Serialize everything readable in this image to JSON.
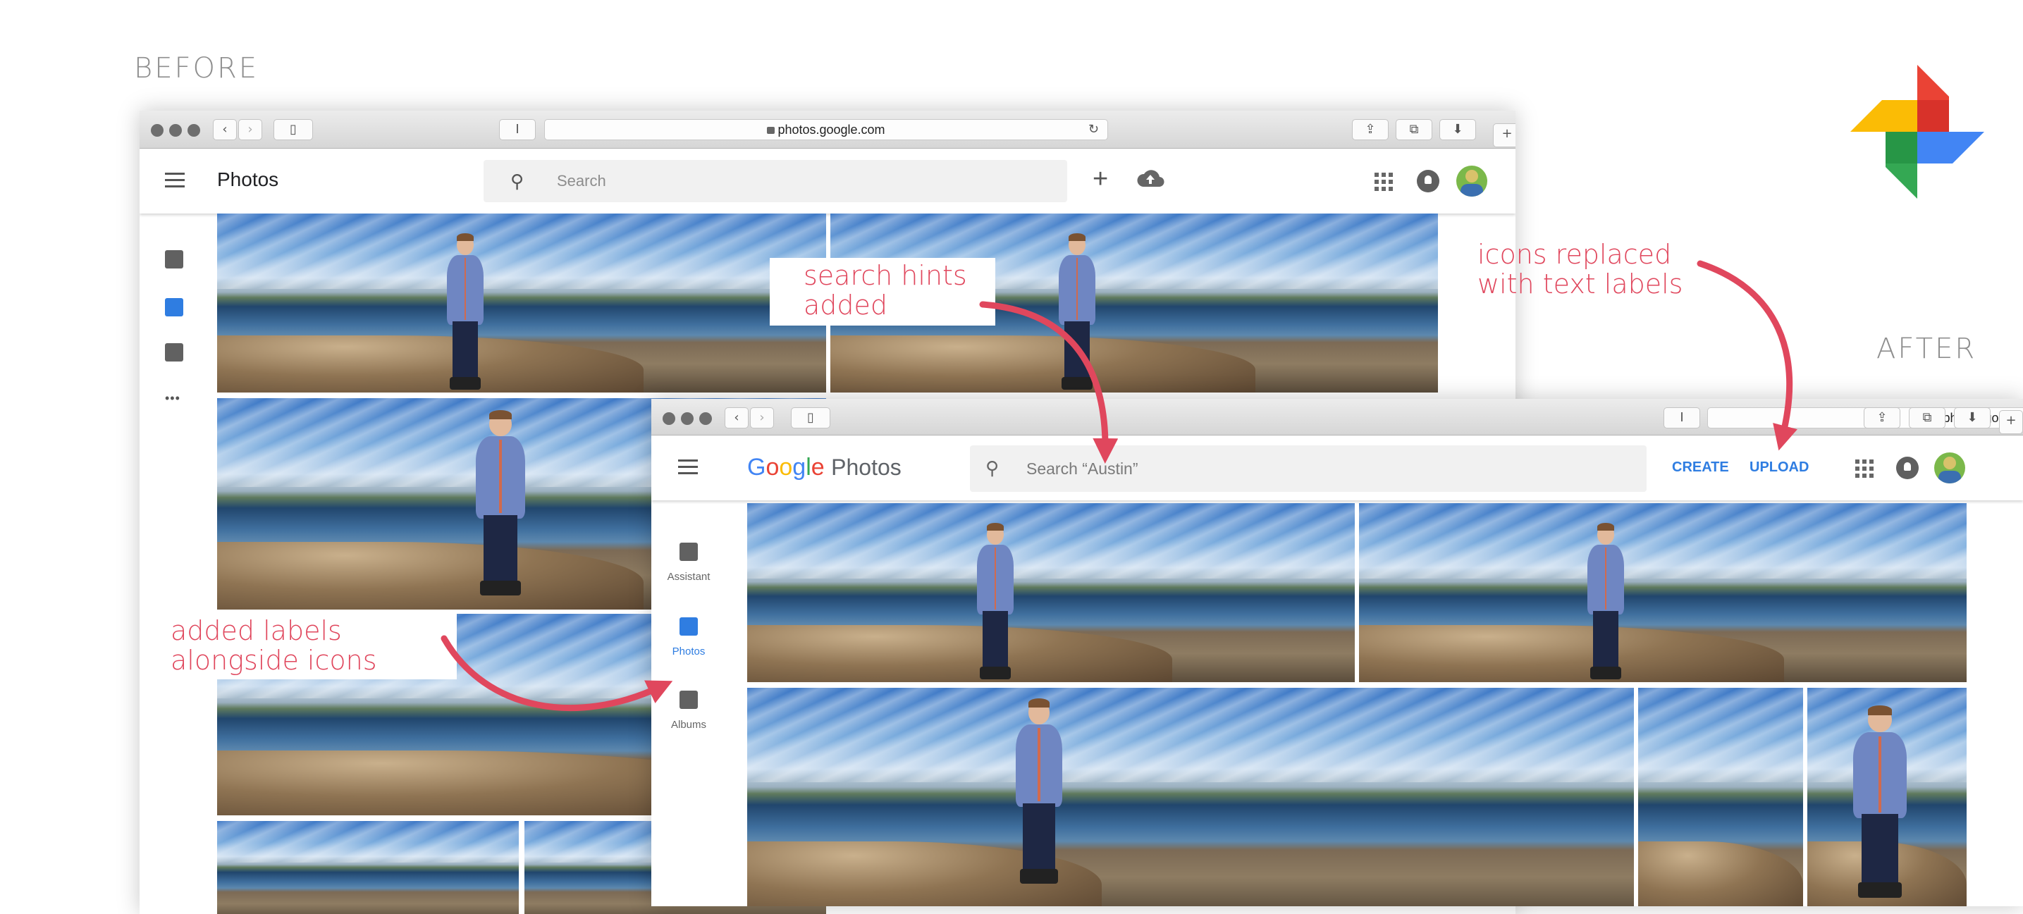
{
  "labels": {
    "before": "BEFORE",
    "after": "AFTER"
  },
  "annotations": {
    "search_hints": [
      "search hints",
      "added"
    ],
    "icons_replaced": [
      "icons replaced",
      "with text labels"
    ],
    "labels_added": [
      "added labels",
      "alongside icons"
    ]
  },
  "before": {
    "url": "photos.google.com",
    "reader_button": "I",
    "app_title": "Photos",
    "search_placeholder": "Search",
    "create_icon": "plus-icon",
    "upload_icon": "cloud-upload-icon",
    "sidebar_icons": [
      "assistant-icon",
      "photos-icon",
      "albums-icon",
      "more-icon"
    ],
    "more_glyph": "•••"
  },
  "after": {
    "url": "photos.google.com",
    "reader_button": "I",
    "brand": {
      "google": [
        "G",
        "o",
        "o",
        "g",
        "l",
        "e"
      ],
      "product": "Photos"
    },
    "brand_colors": [
      "#4285F4",
      "#EA4335",
      "#FBBC05",
      "#4285F4",
      "#34A853",
      "#EA4335"
    ],
    "search_placeholder": "Search “Austin”",
    "create_label": "CREATE",
    "upload_label": "UPLOAD",
    "action_color": "#2f7de1",
    "sidebar": [
      {
        "label": "Assistant",
        "icon": "assistant-icon"
      },
      {
        "label": "Photos",
        "icon": "photos-icon"
      },
      {
        "label": "Albums",
        "icon": "albums-icon"
      }
    ]
  },
  "colors": {
    "annotation": "#e0475d",
    "selected": "#2f7de1"
  }
}
